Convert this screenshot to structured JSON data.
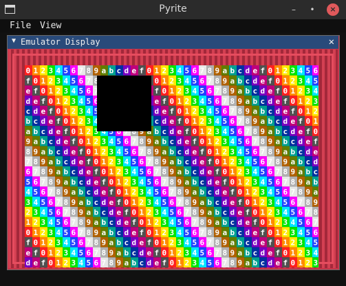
{
  "window": {
    "title": "Pyrite",
    "min": "–",
    "max": "•",
    "close": "×"
  },
  "menu": {
    "file": "File",
    "view": "View"
  },
  "panel": {
    "title": "Emulator Display",
    "collapse": "▼",
    "close": "✕"
  },
  "display": {
    "glyphs": [
      "0",
      "1",
      "2",
      "3",
      "4",
      "5",
      "6",
      "7",
      "8",
      "9",
      "a",
      "b",
      "c",
      "d",
      "e",
      "f"
    ],
    "palette": [
      "#ff2020",
      "#ff8c00",
      "#ffeb00",
      "#00e600",
      "#00e5ff",
      "#2040ff",
      "#ff00ff",
      "#e8e8e8",
      "#b0b0b0",
      "#b06000",
      "#607d00",
      "#00a090",
      "#0030a0",
      "#7a00c0",
      "#c0007a",
      "#505050"
    ]
  }
}
